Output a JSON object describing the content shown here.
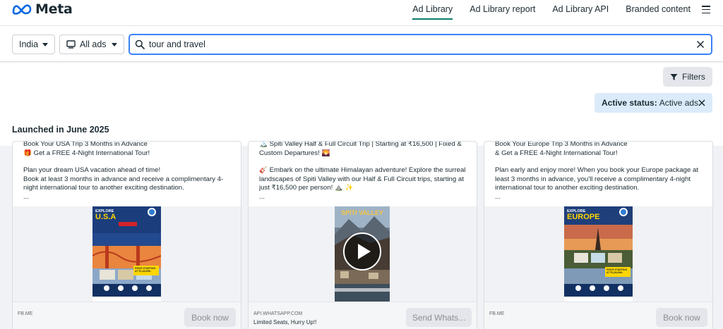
{
  "nav": {
    "brand": "Meta",
    "links": [
      "Ad Library",
      "Ad Library report",
      "Ad Library API",
      "Branded content"
    ]
  },
  "search": {
    "country": "India",
    "ad_type": "All ads",
    "query": "tour and travel"
  },
  "filters": {
    "button_label": "Filters",
    "status_label": "Active status:",
    "status_value": "Active ads"
  },
  "section_title": "Launched in June 2025",
  "colors": {
    "accent": "#0a7c6b",
    "focus": "#3b82f6",
    "chip": "#dcebfa"
  },
  "cards": [
    {
      "lines": [
        "Book Your USA Trip 3 Months in Advance",
        "🎁 Get a FREE 4-Night International Tour!",
        "",
        "Plan your dream USA vacation ahead of time!",
        "Book at least 3 months in advance and receive a complimentary 4-",
        "night international tour to another exciting destination.",
        "..."
      ],
      "poster": {
        "top": "EXPLORE",
        "title": "U.S.A",
        "price": "PRICE STARTING AT ₹1,49,999/-"
      },
      "domain": "FB.ME",
      "subtitle": "",
      "cta": "Book now"
    },
    {
      "lines": [
        "🏔️ Spiti Valley Half & Full Circuit Trip | Starting at ₹16,500 | Fixed &",
        "Custom Departures! 🌄",
        "",
        "🎸 Embark on the ultimate Himalayan adventure! Explore the surreal",
        "landscapes of Spiti Valley with our Half & Full Circuit trips, starting at",
        "just ₹16,500 per person! ⛰️ ✨",
        "..."
      ],
      "poster": {
        "top": "",
        "title": "SPITI VALLEY",
        "price": ""
      },
      "domain": "API.WHATSAPP.COM",
      "subtitle": "Limited Seats, Hurry Up!!",
      "cta": "Send Whats..."
    },
    {
      "lines": [
        "Book Your Europe Trip 3 Months in Advance",
        "& Get a FREE 4-Night International Tour!",
        "",
        "Plan early and enjoy more! When you book your Europe package at",
        "least 3 months in advance, you'll receive a complimentary 4-night",
        "international tour to another exciting destination.",
        "..."
      ],
      "poster": {
        "top": "EXPLORE",
        "title": "EUROPE",
        "price": "PRICE STARTING AT ₹1,89,999/-"
      },
      "domain": "FB.ME",
      "subtitle": "",
      "cta": "Book now"
    }
  ]
}
